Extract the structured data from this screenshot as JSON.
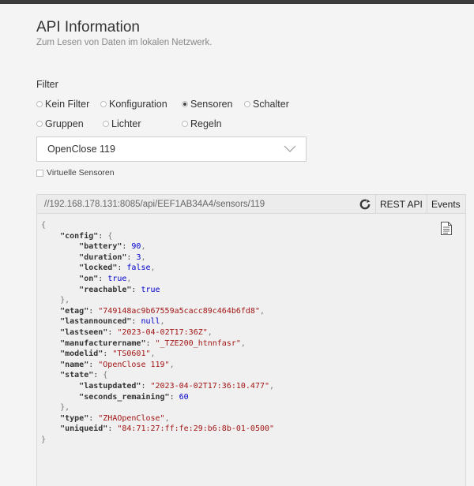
{
  "header": {
    "title": "API Information",
    "subtitle": "Zum Lesen von Daten im lokalen Netzwerk."
  },
  "filter": {
    "label": "Filter",
    "options": [
      {
        "label": "Kein Filter",
        "checked": false
      },
      {
        "label": "Konfiguration",
        "checked": false
      },
      {
        "label": "Sensoren",
        "checked": true
      },
      {
        "label": "Schalter",
        "checked": false
      },
      {
        "label": "Gruppen",
        "checked": false
      },
      {
        "label": "Lichter",
        "checked": false
      },
      {
        "label": "Regeln",
        "checked": false
      }
    ],
    "selected_device": "OpenClose 119",
    "virtual_sensors_label": "Virtuelle Sensoren",
    "virtual_sensors_checked": false
  },
  "api": {
    "url": "//192.168.178.131:8085/api/EEF1AB34A4/sensors/119",
    "rest_label": "REST API",
    "events_label": "Events"
  },
  "json_response": {
    "config": {
      "battery": 90,
      "duration": 3,
      "locked": false,
      "on": true,
      "reachable": true
    },
    "etag": "749148ac9b67559a5cacc89c464b6fd8",
    "lastannounced": null,
    "lastseen": "2023-04-02T17:36Z",
    "manufacturername": "_TZE200_htnnfasr",
    "modelid": "TS0601",
    "name": "OpenClose 119",
    "state": {
      "lastupdated": "2023-04-02T17:36:10.477",
      "seconds_remaining": 60
    },
    "type": "ZHAOpenClose",
    "uniqueid": "84:71:27:ff:fe:29:b6:8b-01-0500"
  }
}
